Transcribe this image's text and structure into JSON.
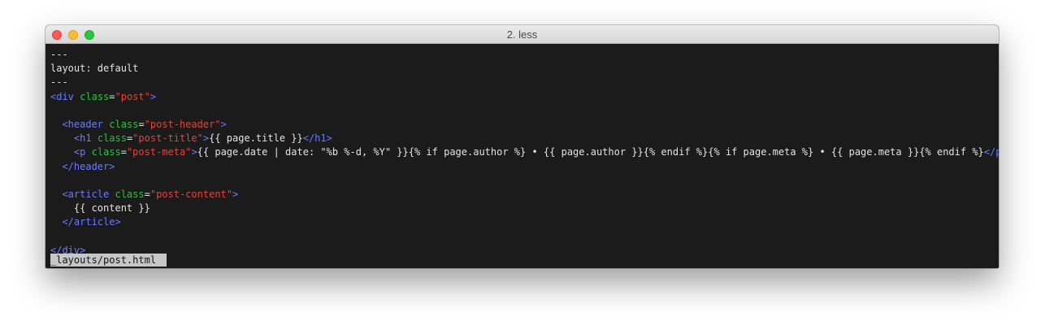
{
  "window": {
    "title": "2. less"
  },
  "terminal": {
    "lines": [
      [
        {
          "t": "---",
          "c": "txt"
        }
      ],
      [
        {
          "t": "layout: default",
          "c": "txt"
        }
      ],
      [
        {
          "t": "---",
          "c": "txt"
        }
      ],
      [
        {
          "t": "<div",
          "c": "tag"
        },
        {
          "t": " ",
          "c": "txt"
        },
        {
          "t": "class",
          "c": "attr"
        },
        {
          "t": "=",
          "c": "txt"
        },
        {
          "t": "\"post\"",
          "c": "str"
        },
        {
          "t": ">",
          "c": "tag"
        }
      ],
      [],
      [
        {
          "t": "  ",
          "c": "txt"
        },
        {
          "t": "<header",
          "c": "tag"
        },
        {
          "t": " ",
          "c": "txt"
        },
        {
          "t": "class",
          "c": "attr"
        },
        {
          "t": "=",
          "c": "txt"
        },
        {
          "t": "\"post-header\"",
          "c": "str"
        },
        {
          "t": ">",
          "c": "tag"
        }
      ],
      [
        {
          "t": "    ",
          "c": "txt"
        },
        {
          "t": "<h1",
          "c": "tag"
        },
        {
          "t": " ",
          "c": "txt"
        },
        {
          "t": "class",
          "c": "attr"
        },
        {
          "t": "=",
          "c": "txt"
        },
        {
          "t": "\"post-title\"",
          "c": "str"
        },
        {
          "t": ">",
          "c": "tag"
        },
        {
          "t": "{{ page.title }}",
          "c": "txt"
        },
        {
          "t": "</h1>",
          "c": "tag"
        }
      ],
      [
        {
          "t": "    ",
          "c": "txt"
        },
        {
          "t": "<p",
          "c": "tag"
        },
        {
          "t": " ",
          "c": "txt"
        },
        {
          "t": "class",
          "c": "attr"
        },
        {
          "t": "=",
          "c": "txt"
        },
        {
          "t": "\"post-meta\"",
          "c": "str"
        },
        {
          "t": ">",
          "c": "tag"
        },
        {
          "t": "{{ page.date | date: \"%b %-d, %Y\" }}{% if page.author %} • {{ page.author }}{% endif %}{% if page.meta %} • {{ page.meta }}{% endif %}",
          "c": "txt"
        },
        {
          "t": "</p>",
          "c": "tag"
        }
      ],
      [
        {
          "t": "  ",
          "c": "txt"
        },
        {
          "t": "</header>",
          "c": "tag"
        }
      ],
      [],
      [
        {
          "t": "  ",
          "c": "txt"
        },
        {
          "t": "<article",
          "c": "tag"
        },
        {
          "t": " ",
          "c": "txt"
        },
        {
          "t": "class",
          "c": "attr"
        },
        {
          "t": "=",
          "c": "txt"
        },
        {
          "t": "\"post-content\"",
          "c": "str"
        },
        {
          "t": ">",
          "c": "tag"
        }
      ],
      [
        {
          "t": "    {{ content }}",
          "c": "txt"
        }
      ],
      [
        {
          "t": "  ",
          "c": "txt"
        },
        {
          "t": "</article>",
          "c": "tag"
        }
      ],
      [],
      [
        {
          "t": "</div>",
          "c": "tag"
        }
      ]
    ],
    "status": "_layouts/post.html"
  },
  "colors": {
    "tag": "#6b7cff",
    "attribute": "#2fbf3b",
    "string": "#e0453d",
    "text": "#e3e3e3",
    "background": "#1b1b1b"
  }
}
